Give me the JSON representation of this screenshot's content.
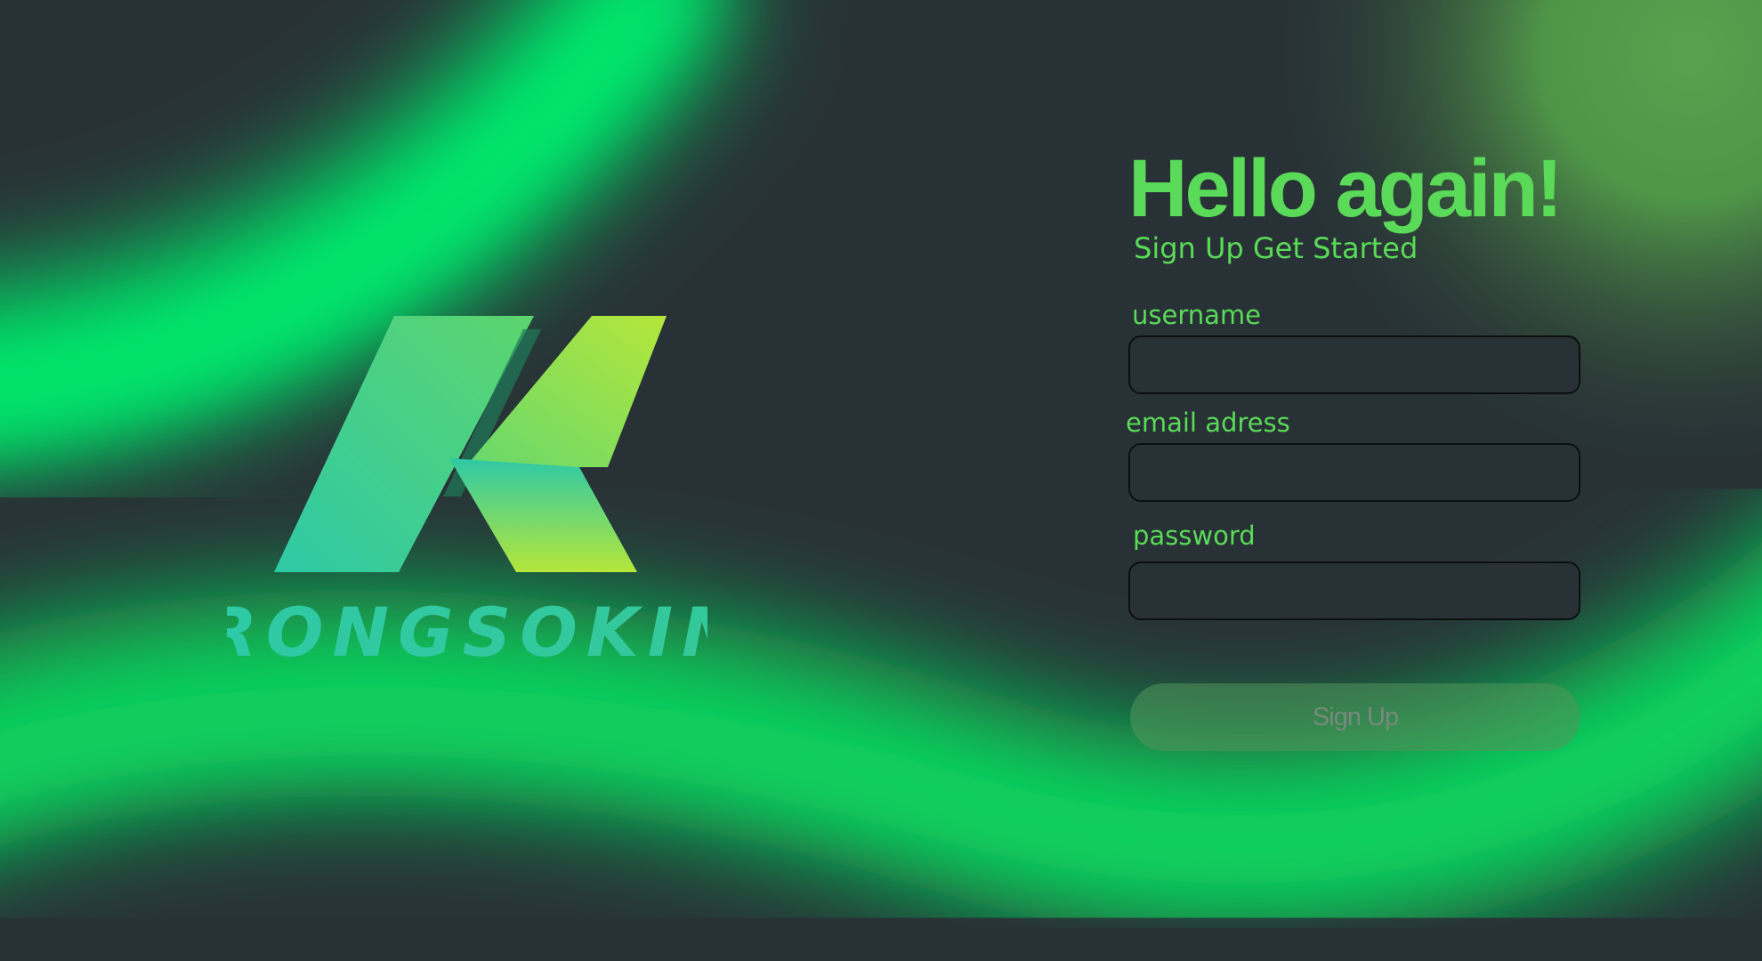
{
  "brand": {
    "name": "RONGSOKIN",
    "logo_icon": "rongsokin-k-logo-icon"
  },
  "form": {
    "heading": "Hello again!",
    "subheading": "Sign Up Get Started",
    "fields": [
      {
        "label": "username",
        "value": "",
        "type": "text"
      },
      {
        "label": "email adress",
        "value": "",
        "type": "email"
      },
      {
        "label": "password",
        "value": "",
        "type": "password"
      }
    ],
    "submit_label": "Sign Up"
  },
  "colors": {
    "background": "#283236",
    "accent": "#5ada58",
    "glow": "#00e36a",
    "logo_teal": "#2ec9a6",
    "logo_lime": "#b5e63a",
    "input_border": "#0b0f10",
    "button_fill": "#4a7a50",
    "button_text": "#788a7c"
  }
}
